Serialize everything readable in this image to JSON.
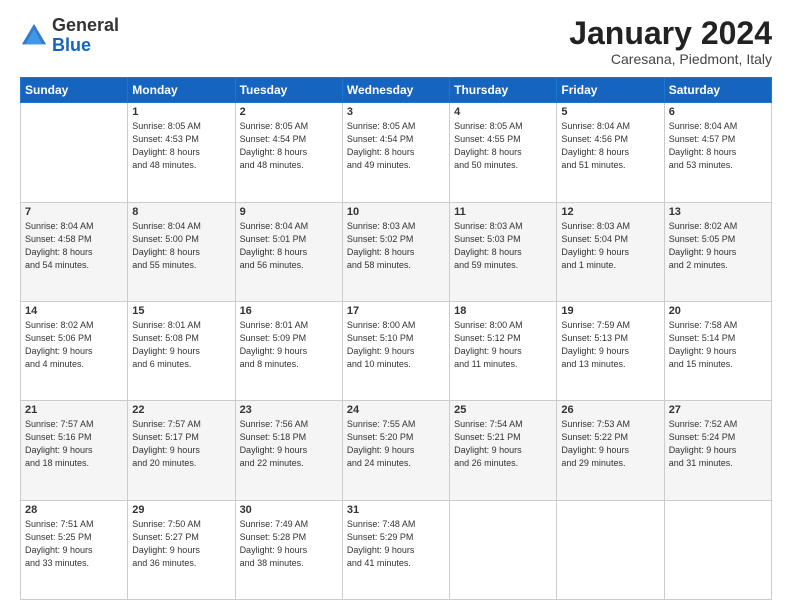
{
  "logo": {
    "general": "General",
    "blue": "Blue"
  },
  "header": {
    "month_year": "January 2024",
    "location": "Caresana, Piedmont, Italy"
  },
  "weekdays": [
    "Sunday",
    "Monday",
    "Tuesday",
    "Wednesday",
    "Thursday",
    "Friday",
    "Saturday"
  ],
  "weeks": [
    [
      {
        "day": "",
        "info": ""
      },
      {
        "day": "1",
        "info": "Sunrise: 8:05 AM\nSunset: 4:53 PM\nDaylight: 8 hours\nand 48 minutes."
      },
      {
        "day": "2",
        "info": "Sunrise: 8:05 AM\nSunset: 4:54 PM\nDaylight: 8 hours\nand 48 minutes."
      },
      {
        "day": "3",
        "info": "Sunrise: 8:05 AM\nSunset: 4:54 PM\nDaylight: 8 hours\nand 49 minutes."
      },
      {
        "day": "4",
        "info": "Sunrise: 8:05 AM\nSunset: 4:55 PM\nDaylight: 8 hours\nand 50 minutes."
      },
      {
        "day": "5",
        "info": "Sunrise: 8:04 AM\nSunset: 4:56 PM\nDaylight: 8 hours\nand 51 minutes."
      },
      {
        "day": "6",
        "info": "Sunrise: 8:04 AM\nSunset: 4:57 PM\nDaylight: 8 hours\nand 53 minutes."
      }
    ],
    [
      {
        "day": "7",
        "info": "Sunrise: 8:04 AM\nSunset: 4:58 PM\nDaylight: 8 hours\nand 54 minutes."
      },
      {
        "day": "8",
        "info": "Sunrise: 8:04 AM\nSunset: 5:00 PM\nDaylight: 8 hours\nand 55 minutes."
      },
      {
        "day": "9",
        "info": "Sunrise: 8:04 AM\nSunset: 5:01 PM\nDaylight: 8 hours\nand 56 minutes."
      },
      {
        "day": "10",
        "info": "Sunrise: 8:03 AM\nSunset: 5:02 PM\nDaylight: 8 hours\nand 58 minutes."
      },
      {
        "day": "11",
        "info": "Sunrise: 8:03 AM\nSunset: 5:03 PM\nDaylight: 8 hours\nand 59 minutes."
      },
      {
        "day": "12",
        "info": "Sunrise: 8:03 AM\nSunset: 5:04 PM\nDaylight: 9 hours\nand 1 minute."
      },
      {
        "day": "13",
        "info": "Sunrise: 8:02 AM\nSunset: 5:05 PM\nDaylight: 9 hours\nand 2 minutes."
      }
    ],
    [
      {
        "day": "14",
        "info": "Sunrise: 8:02 AM\nSunset: 5:06 PM\nDaylight: 9 hours\nand 4 minutes."
      },
      {
        "day": "15",
        "info": "Sunrise: 8:01 AM\nSunset: 5:08 PM\nDaylight: 9 hours\nand 6 minutes."
      },
      {
        "day": "16",
        "info": "Sunrise: 8:01 AM\nSunset: 5:09 PM\nDaylight: 9 hours\nand 8 minutes."
      },
      {
        "day": "17",
        "info": "Sunrise: 8:00 AM\nSunset: 5:10 PM\nDaylight: 9 hours\nand 10 minutes."
      },
      {
        "day": "18",
        "info": "Sunrise: 8:00 AM\nSunset: 5:12 PM\nDaylight: 9 hours\nand 11 minutes."
      },
      {
        "day": "19",
        "info": "Sunrise: 7:59 AM\nSunset: 5:13 PM\nDaylight: 9 hours\nand 13 minutes."
      },
      {
        "day": "20",
        "info": "Sunrise: 7:58 AM\nSunset: 5:14 PM\nDaylight: 9 hours\nand 15 minutes."
      }
    ],
    [
      {
        "day": "21",
        "info": "Sunrise: 7:57 AM\nSunset: 5:16 PM\nDaylight: 9 hours\nand 18 minutes."
      },
      {
        "day": "22",
        "info": "Sunrise: 7:57 AM\nSunset: 5:17 PM\nDaylight: 9 hours\nand 20 minutes."
      },
      {
        "day": "23",
        "info": "Sunrise: 7:56 AM\nSunset: 5:18 PM\nDaylight: 9 hours\nand 22 minutes."
      },
      {
        "day": "24",
        "info": "Sunrise: 7:55 AM\nSunset: 5:20 PM\nDaylight: 9 hours\nand 24 minutes."
      },
      {
        "day": "25",
        "info": "Sunrise: 7:54 AM\nSunset: 5:21 PM\nDaylight: 9 hours\nand 26 minutes."
      },
      {
        "day": "26",
        "info": "Sunrise: 7:53 AM\nSunset: 5:22 PM\nDaylight: 9 hours\nand 29 minutes."
      },
      {
        "day": "27",
        "info": "Sunrise: 7:52 AM\nSunset: 5:24 PM\nDaylight: 9 hours\nand 31 minutes."
      }
    ],
    [
      {
        "day": "28",
        "info": "Sunrise: 7:51 AM\nSunset: 5:25 PM\nDaylight: 9 hours\nand 33 minutes."
      },
      {
        "day": "29",
        "info": "Sunrise: 7:50 AM\nSunset: 5:27 PM\nDaylight: 9 hours\nand 36 minutes."
      },
      {
        "day": "30",
        "info": "Sunrise: 7:49 AM\nSunset: 5:28 PM\nDaylight: 9 hours\nand 38 minutes."
      },
      {
        "day": "31",
        "info": "Sunrise: 7:48 AM\nSunset: 5:29 PM\nDaylight: 9 hours\nand 41 minutes."
      },
      {
        "day": "",
        "info": ""
      },
      {
        "day": "",
        "info": ""
      },
      {
        "day": "",
        "info": ""
      }
    ]
  ]
}
